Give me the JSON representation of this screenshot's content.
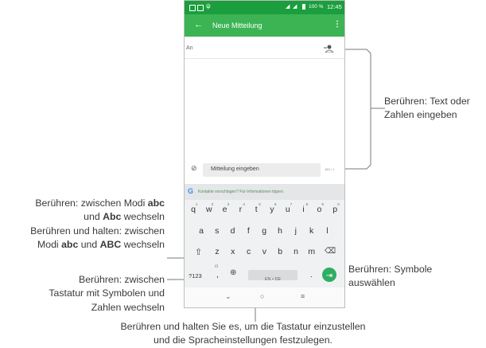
{
  "status_bar": {
    "battery": "100 %",
    "time": "12:45"
  },
  "app_bar": {
    "title": "Neue Mitteilung"
  },
  "recipient": {
    "label": "An"
  },
  "compose": {
    "placeholder": "Mitteilung eingeben",
    "counter": "160 / 1"
  },
  "keyboard": {
    "suggestion": "Kontakte vorschlagen? Für Informationen tippen.",
    "row1": [
      "q",
      "w",
      "e",
      "r",
      "t",
      "y",
      "u",
      "i",
      "o",
      "p"
    ],
    "row1_numbers": [
      "1",
      "2",
      "3",
      "4",
      "5",
      "6",
      "7",
      "8",
      "9",
      "0"
    ],
    "row2": [
      "a",
      "s",
      "d",
      "f",
      "g",
      "h",
      "j",
      "k",
      "l"
    ],
    "row3": [
      "z",
      "x",
      "c",
      "v",
      "b",
      "n",
      "m"
    ],
    "symbols_key": "?123",
    "comma": ",",
    "space_label": "EN • DE",
    "period": "."
  },
  "callouts": {
    "text_input": {
      "line1": "Berühren: Text oder",
      "line2": "Zahlen eingeben"
    },
    "modes": {
      "l1_pre": "Berühren: zwischen Modi ",
      "l1_b": "abc",
      "l2_pre": "und ",
      "l2_b": "Abc",
      "l2_post": " wechseln",
      "l3": "Berühren und halten: zwischen",
      "l4_pre": "Modi ",
      "l4_b1": "abc",
      "l4_mid": " und ",
      "l4_b2": "ABC",
      "l4_post": " wechseln"
    },
    "symbols_toggle": {
      "line1": "Berühren: zwischen",
      "line2": "Tastatur mit Symbolen und",
      "line3": "Zahlen wechseln"
    },
    "symbols_select": {
      "line1": "Berühren: Symbole",
      "line2": "auswählen"
    },
    "language": {
      "line1": "Berühren und halten Sie es, um die Tastatur einzustellen",
      "line2": "und die Spracheinstellungen festzulegen."
    }
  }
}
